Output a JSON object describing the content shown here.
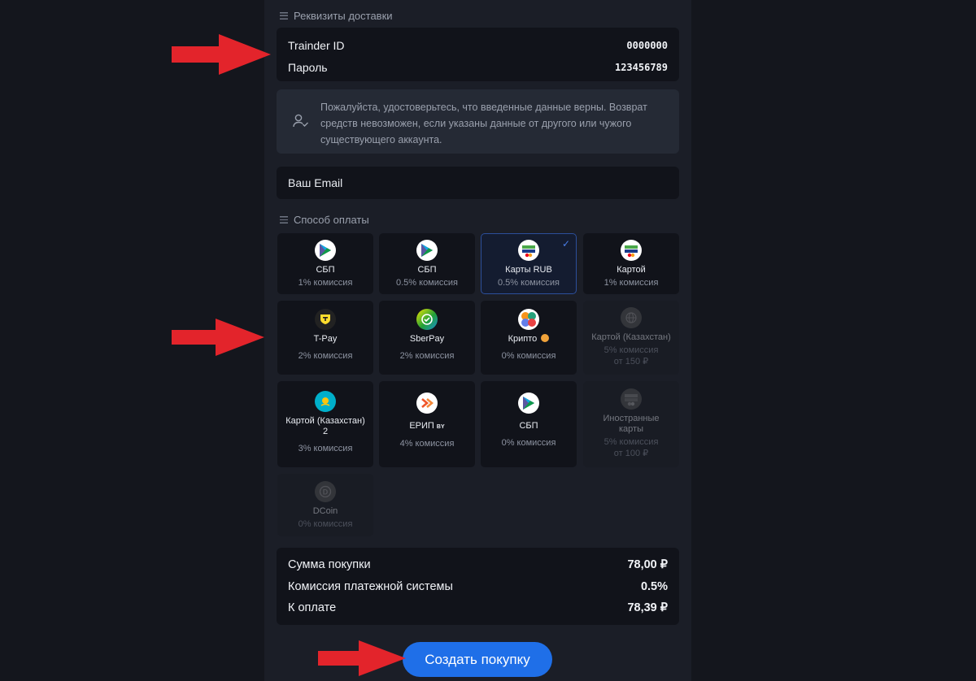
{
  "delivery": {
    "section_title": "Реквизиты доставки",
    "trainder_label": "Trainder ID",
    "trainder_value": "0000000",
    "password_label": "Пароль",
    "password_value": "123456789"
  },
  "notice": {
    "text": "Пожалуйста, удостоверьтесь, что введенные данные верны. Возврат средств невозможен, если указаны данные от другого или чужого существующего аккаунта.",
    "icon": "user-check-icon"
  },
  "email": {
    "placeholder": "Ваш Email"
  },
  "payment": {
    "section_title": "Способ оплаты",
    "methods": [
      {
        "name": "СБП",
        "fee": "1% комиссия",
        "icon": "sbp-icon"
      },
      {
        "name": "СБП",
        "fee": "0.5% комиссия",
        "icon": "sbp-icon"
      },
      {
        "name": "Карты RUB",
        "fee": "0.5% комиссия",
        "icon": "mir-visa-icon",
        "selected": true
      },
      {
        "name": "Картой",
        "fee": "1% комиссия",
        "icon": "mir-visa-icon"
      },
      {
        "name": "T-Pay",
        "fee": "2% комиссия",
        "icon": "tpay-icon"
      },
      {
        "name": "SberPay",
        "fee": "2% комиссия",
        "icon": "sberpay-icon"
      },
      {
        "name": "Крипто",
        "fee": "0% комиссия",
        "icon": "crypto-icon",
        "badge": "coin-badge-icon"
      },
      {
        "name": "Картой (Казахстан)",
        "fee": "5% комиссия",
        "from": "от 150 ₽",
        "icon": "globe-icon",
        "disabled": true
      },
      {
        "name": "Картой (Казахстан) 2",
        "fee": "3% комиссия",
        "icon": "kazakhstan-flag-icon"
      },
      {
        "name": "ЕРИП",
        "suffix": "BY",
        "fee": "4% комиссия",
        "icon": "erip-icon"
      },
      {
        "name": "СБП",
        "fee": "0% комиссия",
        "icon": "sbp-icon"
      },
      {
        "name": "Иностранные карты",
        "fee": "5% комиссия",
        "from": "от 100 ₽",
        "icon": "mir-visa-icon",
        "disabled": true
      },
      {
        "name": "DCoin",
        "fee": "0% комиссия",
        "icon": "dcoin-icon",
        "disabled": true
      }
    ]
  },
  "summary": {
    "purchase_label": "Сумма покупки",
    "purchase_value": "78,00 ₽",
    "commission_label": "Комиссия платежной системы",
    "commission_value": "0.5%",
    "total_label": "К оплате",
    "total_value": "78,39 ₽"
  },
  "submit": {
    "label": "Создать покупку"
  },
  "colors": {
    "accent": "#1f6fe8",
    "arrow": "#e3242b",
    "selected_border": "#2c4f9b"
  }
}
